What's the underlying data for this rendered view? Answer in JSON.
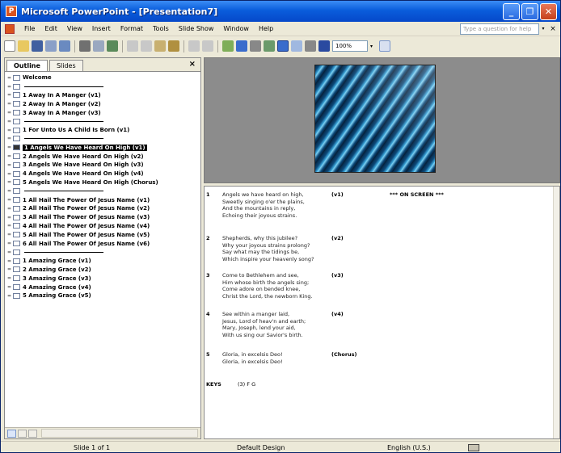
{
  "window": {
    "title": "Microsoft PowerPoint - [Presentation7]",
    "controls": [
      "minimize",
      "restore",
      "close"
    ]
  },
  "menubar": {
    "items": [
      "File",
      "Edit",
      "View",
      "Insert",
      "Format",
      "Tools",
      "Slide Show",
      "Window",
      "Help"
    ],
    "help_placeholder": "Type a question for help",
    "close_glyph": "×"
  },
  "toolbar": {
    "zoom": "100%",
    "colors": {
      "new": "#ffffff",
      "open": "#e8c860",
      "save": "#4060a0",
      "accent": "#3a6ccc"
    }
  },
  "outline": {
    "tabs": [
      "Outline",
      "Slides"
    ],
    "active_tab": "Outline",
    "close_glyph": "×",
    "items": [
      {
        "text": "Welcome",
        "rule": false
      },
      {
        "text": "",
        "rule": true
      },
      {
        "text": "1  Away In A Manger   (v1)",
        "rule": false
      },
      {
        "text": "2  Away In A Manger   (v2)",
        "rule": false
      },
      {
        "text": "3  Away In A Manger   (v3)",
        "rule": false
      },
      {
        "text": "",
        "rule": true
      },
      {
        "text": "1  For Unto Us A Child Is Born  (v1)",
        "rule": false
      },
      {
        "text": "",
        "rule": true
      },
      {
        "text": "1  Angels We Have Heard On High  (v1)",
        "rule": false,
        "selected": true
      },
      {
        "text": "2  Angels We Have Heard On High  (v2)",
        "rule": false
      },
      {
        "text": "3  Angels We Have Heard On High  (v3)",
        "rule": false
      },
      {
        "text": "4  Angels We Have Heard On High  (v4)",
        "rule": false
      },
      {
        "text": "5  Angels We Have Heard On High  (Chorus)",
        "rule": false
      },
      {
        "text": "",
        "rule": true
      },
      {
        "text": "1  All Hail The Power Of Jesus Name  (v1)",
        "rule": false
      },
      {
        "text": "2  All Hail The Power Of Jesus Name  (v2)",
        "rule": false
      },
      {
        "text": "3  All Hail The Power Of Jesus Name  (v3)",
        "rule": false
      },
      {
        "text": "4  All Hail The Power Of Jesus Name  (v4)",
        "rule": false
      },
      {
        "text": "5  All Hail The Power Of Jesus Name  (v5)",
        "rule": false
      },
      {
        "text": "6  All Hail The Power Of Jesus Name  (v6)",
        "rule": false
      },
      {
        "text": "",
        "rule": true
      },
      {
        "text": "1  Amazing Grace  (v1)",
        "rule": false
      },
      {
        "text": "2  Amazing Grace  (v2)",
        "rule": false
      },
      {
        "text": "3  Amazing Grace  (v3)",
        "rule": false
      },
      {
        "text": "4  Amazing Grace  (v4)",
        "rule": false
      },
      {
        "text": "5  Amazing Grace  (v5)",
        "rule": false
      }
    ]
  },
  "slide": {
    "image": "blue-abstract-curves",
    "colors": [
      "#062a4a",
      "#3ba5da",
      "#7fd2f4"
    ]
  },
  "notes": {
    "on_screen": "*** ON SCREEN ***",
    "stanzas": [
      {
        "num": "1",
        "tag": "(v1)",
        "lines": [
          "Angels we have heard on high,",
          "Sweetly singing o'er the plains,",
          "And the mountains in reply,",
          "Echoing their joyous strains."
        ]
      },
      {
        "num": "2",
        "tag": "(v2)",
        "lines": [
          "Shepherds, why this jubilee?",
          "Why your joyous strains prolong?",
          "Say what may the tidings be,",
          "Which inspire your heavenly song?"
        ]
      },
      {
        "num": "3",
        "tag": "(v3)",
        "lines": [
          "Come to Bethlehem and see,",
          "Him whose birth the angels sing;",
          "Come adore on bended knee,",
          "Christ the Lord, the newborn King."
        ]
      },
      {
        "num": "4",
        "tag": "(v4)",
        "lines": [
          "See within a manger laid,",
          "Jesus, Lord of heav'n and earth;",
          "Mary, Joseph, lend your aid,",
          "With us sing our Savior's birth."
        ]
      },
      {
        "num": "5",
        "tag": "(Chorus)",
        "lines": [
          "Gloria, in excelsis Deo!",
          "Gloria, in excelsis Deo!"
        ]
      }
    ],
    "keys_label": "KEYS",
    "keys_value": "(3) F G"
  },
  "status": {
    "slide": "Slide 1 of 1",
    "design": "Default Design",
    "language": "English (U.S.)",
    "icon": "spellcheck-icon"
  }
}
